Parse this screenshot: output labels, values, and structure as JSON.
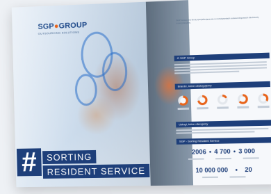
{
  "brochure": {
    "logo": {
      "brand": "SGP",
      "separator": "●",
      "group": "GROUP",
      "tagline": "OUTSOURCING SOLUTIONS"
    },
    "cover": {
      "hash_symbol": "#",
      "title_line_1": "SORTING",
      "title_line_2": "RESIDENT SERVICE"
    },
    "right_page": {
      "top_note": "SGP Group jest firmą specjalizującą się w rozwiązaniach outsourcingowych dla branży motoryzacyjnej.",
      "sections": [
        "O SGP Group",
        "Branże, które obsługujemy",
        "Usługi, które oferujemy",
        "SGP - Sorting Resident Service"
      ],
      "donut_values": [
        0.64,
        0.73,
        0.18,
        0.65,
        0.35
      ],
      "stats_row_1": [
        "2006",
        "4 700",
        "3 000"
      ],
      "stats_row_2": [
        "10 000 000",
        "20"
      ]
    }
  }
}
